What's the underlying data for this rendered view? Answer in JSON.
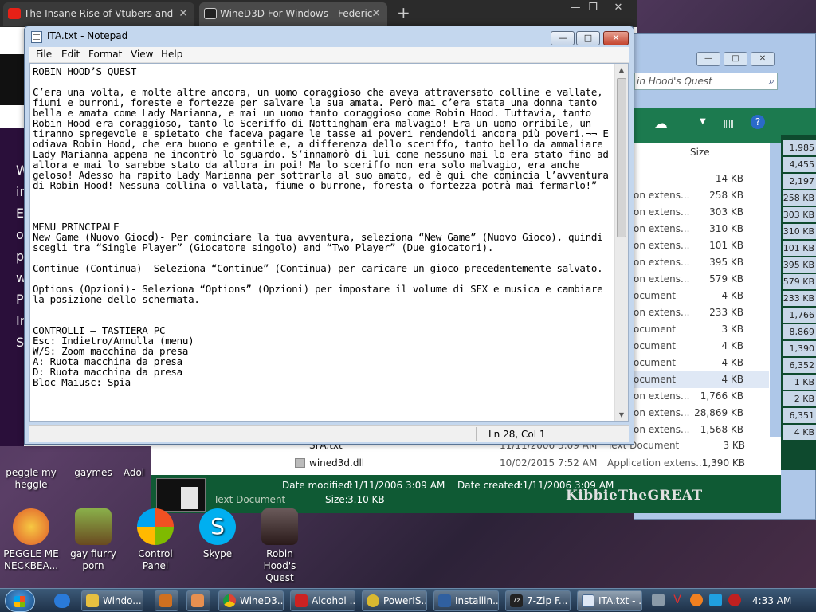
{
  "browser": {
    "tabs": [
      {
        "title": "The Insane Rise of Vtubers and",
        "icon_color": "#e62117"
      },
      {
        "title": "WineD3D For Windows - Federic",
        "icon_color": "#222222"
      }
    ],
    "new_tab": "+",
    "left_text": [
      "W",
      "in",
      "E",
      "o",
      "p",
      "w",
      "P",
      "In",
      "S"
    ]
  },
  "notepad": {
    "title": "ITA.txt - Notepad",
    "menu": [
      "File",
      "Edit",
      "Format",
      "View",
      "Help"
    ],
    "content": "ROBIN HOOD’S QUEST\n\nC’era una volta, e molte altre ancora, un uomo coraggioso che aveva attraversato colline e vallate, fiumi e burroni, foreste e fortezze per salvare la sua amata. Però mai c’era stata una donna tanto bella e amata come Lady Marianna, e mai un uomo tanto coraggioso come Robin Hood. Tuttavia, tanto Robin Hood era coraggioso, tanto lo Sceriffo di Nottingham era malvagio! Era un uomo orribile, un tiranno spregevole e spietato che faceva pagare le tasse ai poveri rendendoli ancora più poveri.¬¬ E odiava Robin Hood, che era buono e gentile e, a differenza dello sceriffo, tanto bello da ammaliare Lady Marianna appena ne incontrò lo sguardo. S’innamorò di lui come nessuno mai lo era stato fino ad allora e mai lo sarebbe stato da allora in poi! Ma lo sceriffo non era solo malvagio, era anche geloso! Adesso ha rapito Lady Marianna per sottrarla al suo amato, ed è qui che comincia l’avventura di Robin Hood! Nessuna collina o vallata, fiume o burrone, foresta o fortezza potrà mai fermarlo!”\n\n\n\nMENU PRINCIPALE\nNew Game (Nuovo Gioco)- Per cominciare la tua avventura, seleziona “New Game” (Nuovo Gioco), quindi scegli tra “Single Player” (Giocatore singolo) and “Two Player” (Due giocatori).\n\nContinue (Continua)- Seleziona “Continue” (Continua) per caricare un gioco precedentemente salvato.\n\nOptions (Opzioni)- Seleziona “Options” (Opzioni) per impostare il volume di SFX e musica e cambiare la posizione dello schermata.\n\n\nCONTROLLI – TASTIERA PC\nEsc: Indietro/Annulla (menu)\nW/S: Zoom macchina da presa\nA: Ruota macchina da presa\nD: Ruota macchina da presa\nBloc Maiusc: Spia",
    "status": "Ln 28, Col 1",
    "buttons": {
      "minimize": "—",
      "maximize": "□",
      "close": "✕"
    }
  },
  "explorer": {
    "search_placeholder": "in Hood's Quest",
    "size_header": "Size",
    "rows": [
      {
        "type": "",
        "size": "14 KB"
      },
      {
        "type": "on extens...",
        "size": "258 KB"
      },
      {
        "type": "on extens...",
        "size": "303 KB"
      },
      {
        "type": "on extens...",
        "size": "310 KB"
      },
      {
        "type": "on extens...",
        "size": "101 KB"
      },
      {
        "type": "on extens...",
        "size": "395 KB"
      },
      {
        "type": "on extens...",
        "size": "579 KB"
      },
      {
        "type": "ocument",
        "size": "4 KB"
      },
      {
        "type": "on extens...",
        "size": "233 KB"
      },
      {
        "type": "ocument",
        "size": "3 KB"
      },
      {
        "type": "ocument",
        "size": "4 KB"
      },
      {
        "type": "ocument",
        "size": "4 KB"
      },
      {
        "type": "ocument",
        "size": "4 KB"
      },
      {
        "type": "on extens...",
        "size": "1,766 KB"
      },
      {
        "type": "on extens...",
        "size": "28,869 KB"
      },
      {
        "type": "on extens...",
        "size": "1,568 KB"
      }
    ],
    "right_sizes": [
      "1,985 KB",
      "4,455 KB",
      "2,197 KB",
      "258 KB",
      "303 KB",
      "310 KB",
      "101 KB",
      "395 KB",
      "579 KB",
      "233 KB",
      "1,766 KB",
      "8,869 KB",
      "1,390 KB",
      "6,352 KB",
      "1 KB",
      "2 KB",
      "6,351 KB",
      "4 KB"
    ],
    "bottom_rows": [
      {
        "name": "SFA.txt",
        "date": "11/11/2006 3:09 AM",
        "type": "Text Document",
        "size": "3 KB"
      },
      {
        "name": "wined3d.dll",
        "date": "10/02/2015 7:52 AM",
        "type": "Application extens...",
        "size": "1,390 KB"
      }
    ],
    "details": {
      "type": "Text Document",
      "modified_label": "Date modified:",
      "modified": "11/11/2006 3:09 AM",
      "created_label": "Date created:",
      "created": "11/11/2006 3:09 AM",
      "size_label": "Size:",
      "size": "3.10 KB",
      "watermark": "KibbieTheGREAT"
    }
  },
  "desktop": {
    "icons": [
      {
        "label": "peggle my heggle",
        "color": "#b04ac0"
      },
      {
        "label": "gaymes",
        "color": "#7a5aa0"
      },
      {
        "label": "Adol",
        "color": "#5a3a6a"
      },
      {
        "label": "PEGGLE ME NECKBEA...",
        "color": "#e05a2a"
      },
      {
        "label": "gay fiurry porn",
        "color": "#9a7a30"
      },
      {
        "label": "Control Panel",
        "color": "#4a7ac8"
      },
      {
        "label": "Skype",
        "color": "#00aff0"
      },
      {
        "label": "Robin Hood's Quest",
        "color": "#3a2a2a"
      }
    ]
  },
  "taskbar": {
    "buttons": [
      {
        "label": "Windo...",
        "color": "#e8c040"
      },
      {
        "label": "",
        "color": "#d07020"
      },
      {
        "label": "",
        "color": "#e89050"
      },
      {
        "label": "WineD3...",
        "color": "#dd4433"
      },
      {
        "label": "Alcohol ...",
        "color": "#cc2222"
      },
      {
        "label": "PowerIS...",
        "color": "#d8b830"
      },
      {
        "label": "Installin...",
        "color": "#3060a0"
      },
      {
        "label": "7-Zip F...",
        "color": "#222222"
      },
      {
        "label": "ITA.txt - ...",
        "color": "#dfe8f5"
      }
    ],
    "clock": "4:33 AM"
  }
}
